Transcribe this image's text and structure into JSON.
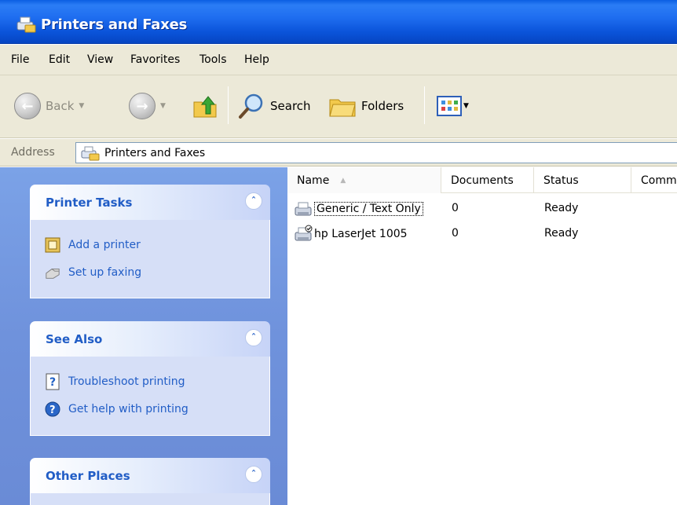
{
  "window": {
    "title": "Printers and Faxes",
    "icon": "printers-folder-icon"
  },
  "menubar": {
    "items": [
      "File",
      "Edit",
      "View",
      "Favorites",
      "Tools",
      "Help"
    ]
  },
  "toolbar": {
    "back_label": "Back",
    "search_label": "Search",
    "folders_label": "Folders",
    "icons": {
      "back": "back-arrow-icon",
      "forward": "forward-arrow-icon",
      "up": "up-folder-icon",
      "search": "search-icon",
      "folders": "folders-icon",
      "views": "views-icon"
    }
  },
  "address": {
    "label": "Address",
    "value": "Printers and Faxes"
  },
  "taskpane": {
    "panels": [
      {
        "title": "Printer Tasks",
        "items": [
          {
            "label": "Add a printer",
            "icon": "add-printer-icon"
          },
          {
            "label": "Set up faxing",
            "icon": "fax-icon"
          }
        ]
      },
      {
        "title": "See Also",
        "items": [
          {
            "label": "Troubleshoot printing",
            "icon": "help-page-icon"
          },
          {
            "label": "Get help with printing",
            "icon": "help-circle-icon"
          }
        ]
      },
      {
        "title": "Other Places",
        "items": []
      }
    ]
  },
  "list": {
    "columns": [
      "Name",
      "Documents",
      "Status",
      "Comm"
    ],
    "rows": [
      {
        "name": "Generic / Text Only",
        "documents": "0",
        "status": "Ready"
      },
      {
        "name": "hp LaserJet 1005",
        "documents": "0",
        "status": "Ready"
      }
    ]
  },
  "colors": {
    "title_bar": "#0a53d9",
    "task_pane": "#6f92dc",
    "panel_title": "#215dc6",
    "panel_body": "#d6dff7"
  }
}
